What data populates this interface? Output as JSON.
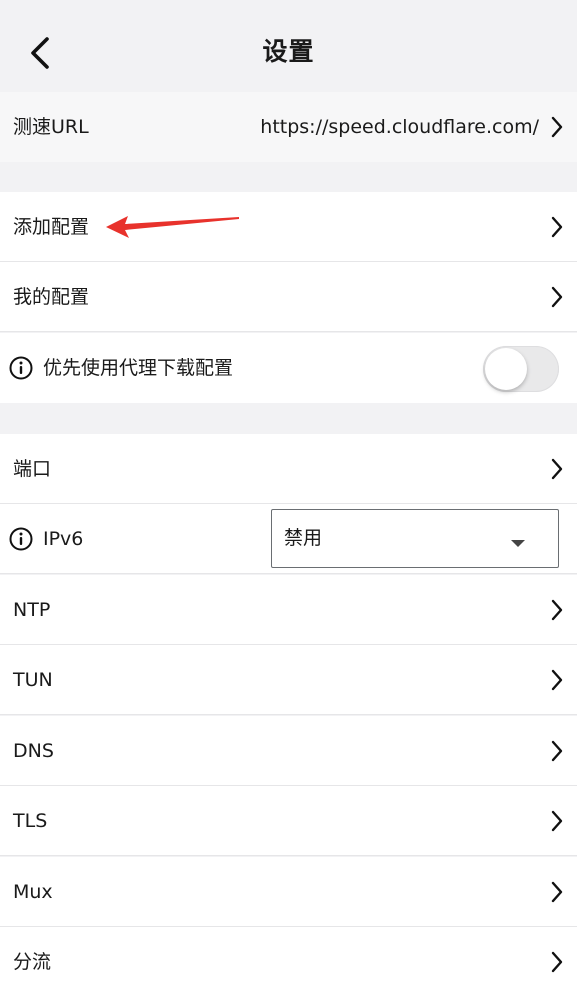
{
  "header": {
    "title": "设置",
    "back_icon": "chevron-left-icon"
  },
  "speedtest": {
    "label": "测速URL",
    "value": "https://speed.cloudflare.com/"
  },
  "config_section": {
    "add_config": "添加配置",
    "my_config": "我的配置",
    "proxy_download": {
      "label": "优先使用代理下载配置",
      "enabled": false
    }
  },
  "network_section": {
    "port": "端口",
    "ipv6": {
      "label": "IPv6",
      "selected": "禁用"
    },
    "ntp": "NTP",
    "tun": "TUN",
    "dns": "DNS",
    "tls": "TLS",
    "mux": "Mux",
    "routing": "分流"
  },
  "colors": {
    "background": "#f2f2f4",
    "annotation_arrow": "#e8322c"
  }
}
